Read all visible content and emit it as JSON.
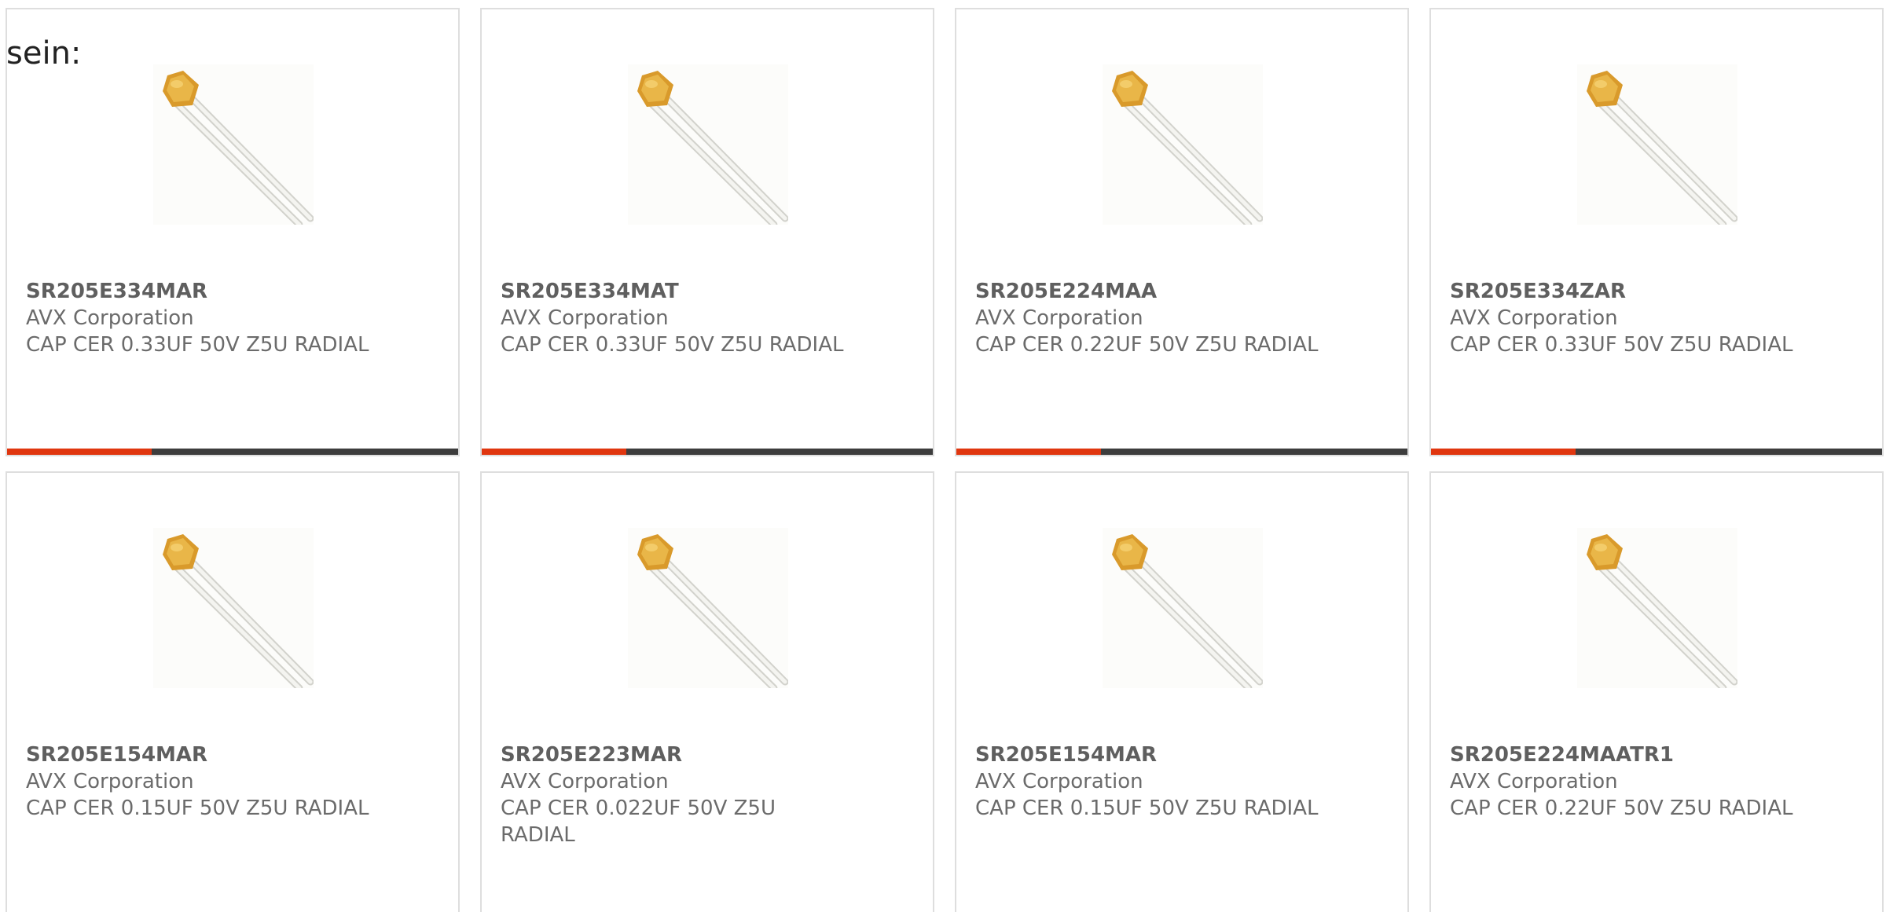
{
  "intro_text": "sein:",
  "colors": {
    "accent": "#e0360f",
    "bar_dark": "#3d3d3d",
    "card_border": "#dedede",
    "text_gray": "#6b6b6b"
  },
  "product_image_icon": "radial-ceramic-capacitor-icon",
  "products": [
    {
      "part": "SR205E334MAR",
      "manufacturer": "AVX Corporation",
      "description": "CAP CER 0.33UF 50V Z5U RADIAL"
    },
    {
      "part": "SR205E334MAT",
      "manufacturer": "AVX Corporation",
      "description": "CAP CER 0.33UF 50V Z5U RADIAL"
    },
    {
      "part": "SR205E224MAA",
      "manufacturer": "AVX Corporation",
      "description": "CAP CER 0.22UF 50V Z5U RADIAL"
    },
    {
      "part": "SR205E334ZAR",
      "manufacturer": "AVX Corporation",
      "description": "CAP CER 0.33UF 50V Z5U RADIAL"
    },
    {
      "part": "SR205E154MAR",
      "manufacturer": "AVX Corporation",
      "description": "CAP CER 0.15UF 50V Z5U RADIAL"
    },
    {
      "part": "SR205E223MAR",
      "manufacturer": "AVX Corporation",
      "description": "CAP CER 0.022UF 50V Z5U RADIAL"
    },
    {
      "part": "SR205E154MAR",
      "manufacturer": "AVX Corporation",
      "description": "CAP CER 0.15UF 50V Z5U RADIAL"
    },
    {
      "part": "SR205E224MAATR1",
      "manufacturer": "AVX Corporation",
      "description": "CAP CER 0.22UF 50V Z5U RADIAL"
    }
  ]
}
